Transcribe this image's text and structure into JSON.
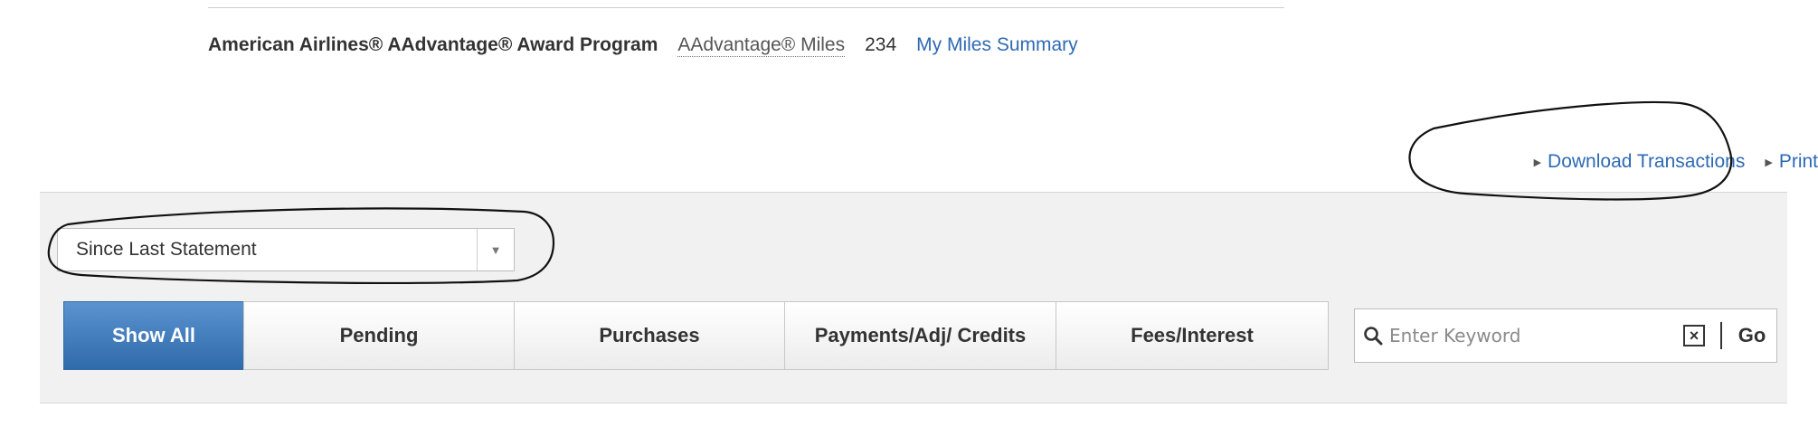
{
  "rewards": {
    "program_name": "American Airlines® AAdvantage® Award Program",
    "miles_label": "AAdvantage® Miles",
    "miles_value": "234",
    "summary_link": "My Miles Summary"
  },
  "actions": {
    "download_label": "Download Transactions",
    "print_label": "Print"
  },
  "filter": {
    "period_selected": "Since Last Statement"
  },
  "tabs": [
    {
      "label": "Show All",
      "active": true
    },
    {
      "label": "Pending",
      "active": false
    },
    {
      "label": "Purchases",
      "active": false
    },
    {
      "label": "Payments/Adj/ Credits",
      "active": false
    },
    {
      "label": "Fees/Interest",
      "active": false
    }
  ],
  "search": {
    "placeholder": "Enter Keyword",
    "clear_label": "×",
    "go_label": "Go"
  },
  "colors": {
    "link": "#2e6ab3",
    "active_tab": "#2f6aab",
    "panel_background": "#f1f1f1",
    "annotation_ink": "#111111"
  },
  "icons": [
    "triangle-right-icon",
    "chevron-down-icon",
    "search-icon",
    "close-icon"
  ]
}
